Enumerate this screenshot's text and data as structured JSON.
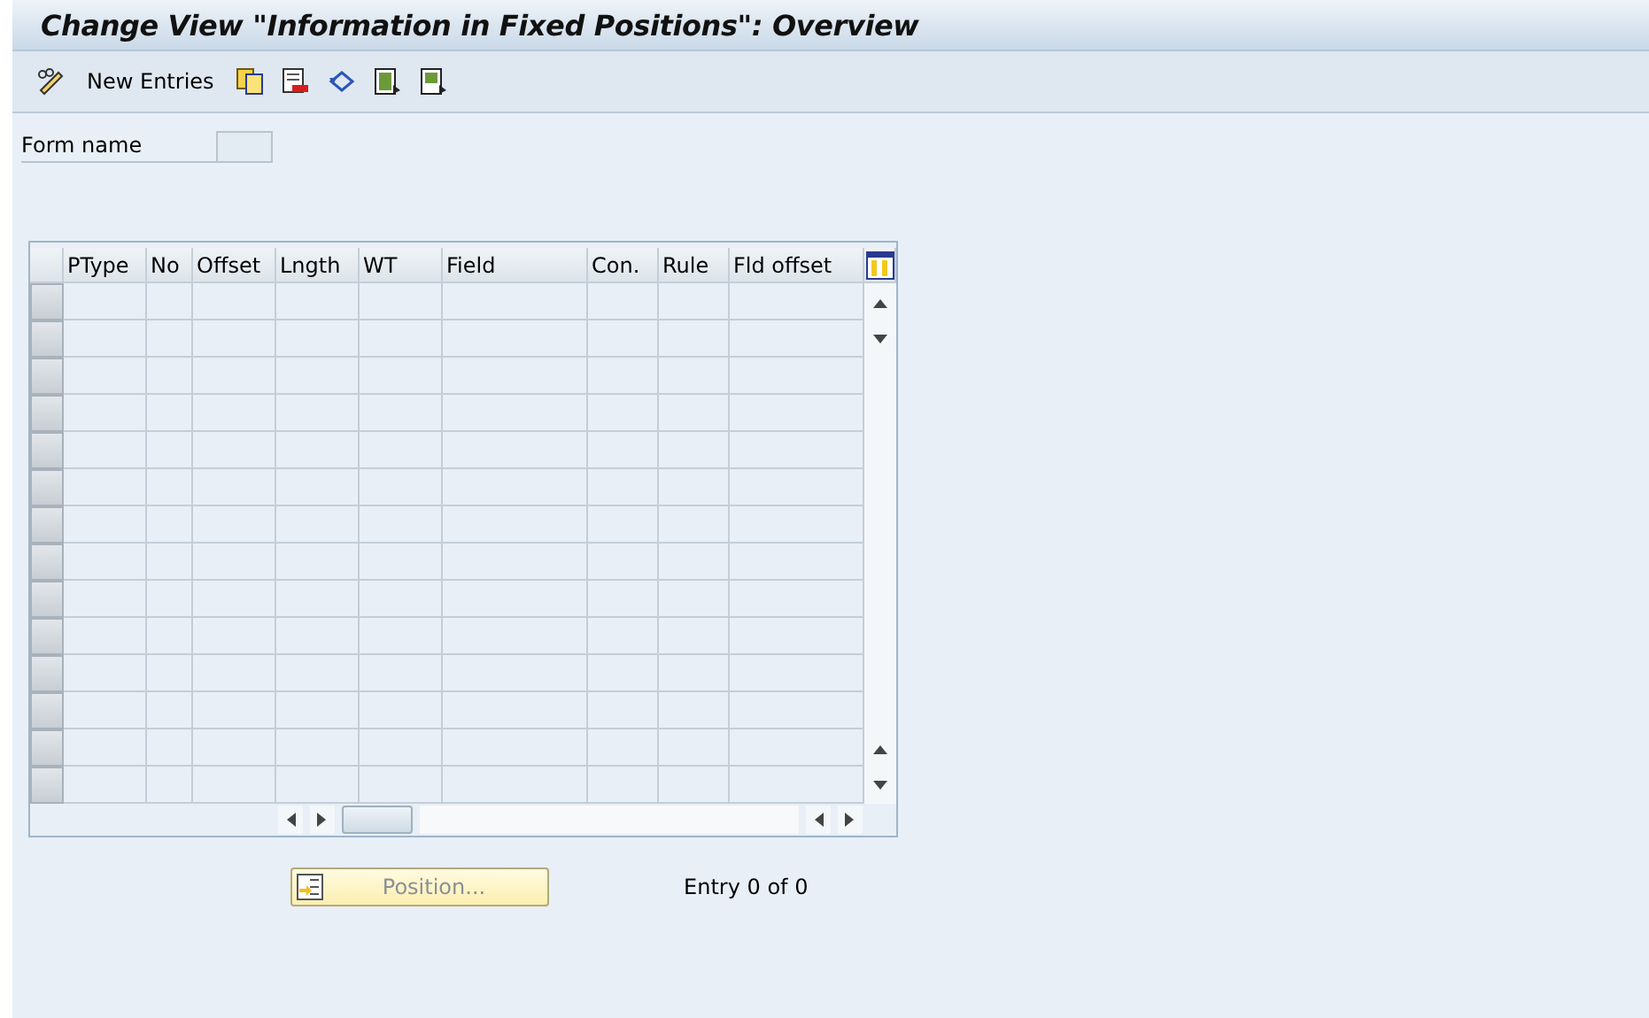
{
  "window": {
    "title": "Change View \"Information in Fixed Positions\": Overview"
  },
  "toolbar": {
    "new_entries": "New Entries"
  },
  "form": {
    "label": "Form name"
  },
  "table": {
    "columns": [
      "PType",
      "No",
      "Offset",
      "Lngth",
      "WT",
      "Field",
      "Con.",
      "Rule",
      "Fld offset"
    ]
  },
  "position_button": {
    "label": "Position..."
  },
  "entry_count": "Entry 0 of 0"
}
